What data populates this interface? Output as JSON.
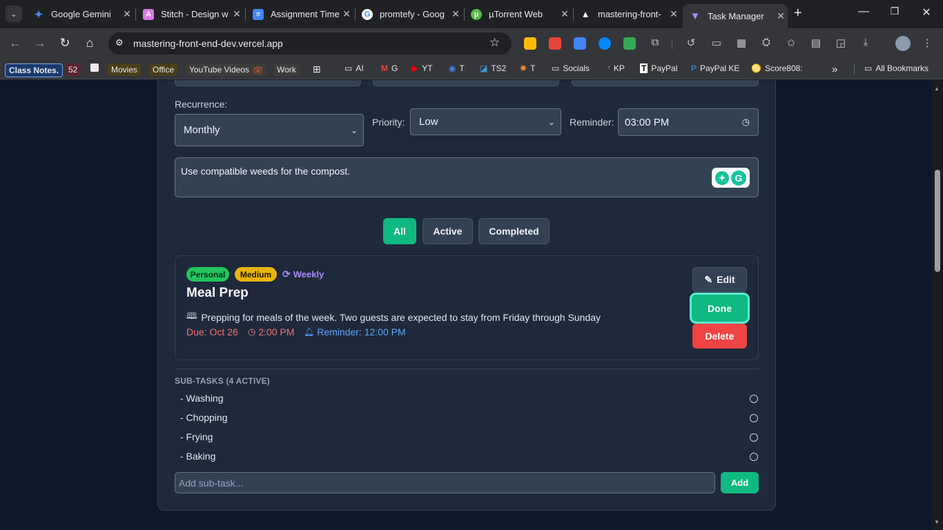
{
  "browser": {
    "tabs": [
      {
        "title": "Google Gemini",
        "active": false
      },
      {
        "title": "Stitch - Design w",
        "active": false
      },
      {
        "title": "Assignment Time",
        "active": false
      },
      {
        "title": "promtefy - Goog",
        "active": false
      },
      {
        "title": "µTorrent Web",
        "active": false
      },
      {
        "title": "mastering-front-",
        "active": false
      },
      {
        "title": "Task Manager",
        "active": true
      }
    ],
    "url": "mastering-front-end-dev.vercel.app",
    "bookmarks": [
      {
        "label": "Class Notes."
      },
      {
        "label": "52"
      },
      {
        "label": "Movies"
      },
      {
        "label": "Office"
      },
      {
        "label": "YouTube Videos"
      },
      {
        "label": "Work"
      },
      {
        "label": "AI"
      },
      {
        "label": "G"
      },
      {
        "label": "YT"
      },
      {
        "label": "T"
      },
      {
        "label": "TS2"
      },
      {
        "label": "T"
      },
      {
        "label": "Socials"
      },
      {
        "label": "KP"
      },
      {
        "label": "PayPal"
      },
      {
        "label": "PayPal KE"
      },
      {
        "label": "Score808:"
      },
      {
        "label": "All Bookmarks"
      }
    ]
  },
  "form": {
    "recurrence_label": "Recurrence:",
    "recurrence_value": "Monthly",
    "priority_label": "Priority:",
    "priority_value": "Low",
    "reminder_label": "Reminder:",
    "reminder_value": "03:00 PM",
    "notes": "Use compatible weeds for the compost."
  },
  "filters": {
    "all": "All",
    "active": "Active",
    "completed": "Completed",
    "selected": "All"
  },
  "task": {
    "category": "Personal",
    "priority": "Medium",
    "recurrence": "Weekly",
    "title": "Meal Prep",
    "description": "Prepping for meals of the week. Two guests are expected to stay from Friday through Sunday",
    "due": "Due: Oct 26",
    "time": "2:00 PM",
    "reminder": "Reminder: 12:00 PM",
    "edit_label": "Edit",
    "done_label": "Done",
    "delete_label": "Delete"
  },
  "subtasks": {
    "header": "SUB-TASKS (4 ACTIVE)",
    "items": [
      {
        "label": "- Washing",
        "done": false
      },
      {
        "label": "- Chopping",
        "done": false
      },
      {
        "label": "- Frying",
        "done": false
      },
      {
        "label": "- Baking",
        "done": false
      }
    ],
    "input_placeholder": "Add sub-task...",
    "add_label": "Add"
  },
  "colors": {
    "accent": "#10b981",
    "danger": "#ef4444",
    "personal_badge": "#22c55e",
    "medium_badge": "#eab308",
    "recurrence": "#a78bfa",
    "due": "#f87171",
    "reminder": "#60a5fa"
  }
}
